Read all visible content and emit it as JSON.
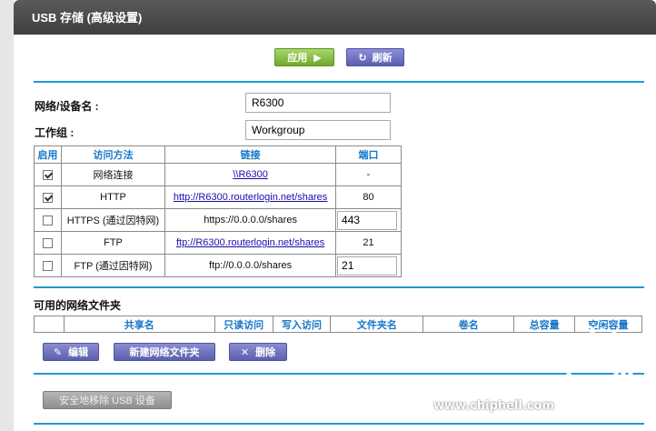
{
  "window": {
    "title": "USB 存储 (高级设置)"
  },
  "toolbar": {
    "apply_label": "应用",
    "refresh_label": "刷新"
  },
  "form": {
    "device_name_label": "网络/设备名 :",
    "device_name_value": "R6300",
    "workgroup_label": "工作组 :",
    "workgroup_value": "Workgroup"
  },
  "access_table": {
    "headers": [
      "启用",
      "访问方法",
      "链接",
      "端口"
    ],
    "rows": [
      {
        "enabled": true,
        "method": "网络连接",
        "link": "\\\\R6300",
        "link_is_url": true,
        "port": "-",
        "port_editable": false
      },
      {
        "enabled": true,
        "method": "HTTP",
        "link": "http://R6300.routerlogin.net/shares",
        "link_is_url": true,
        "port": "80",
        "port_editable": false
      },
      {
        "enabled": false,
        "method": "HTTPS (通过因特网)",
        "link": "https://0.0.0.0/shares",
        "link_is_url": false,
        "port": "443",
        "port_editable": true
      },
      {
        "enabled": false,
        "method": "FTP",
        "link": "ftp://R6300.routerlogin.net/shares",
        "link_is_url": true,
        "port": "21",
        "port_editable": false
      },
      {
        "enabled": false,
        "method": "FTP (通过因特网)",
        "link": "ftp://0.0.0.0/shares",
        "link_is_url": false,
        "port": "21",
        "port_editable": true
      }
    ]
  },
  "folders": {
    "section_title": "可用的网络文件夹",
    "headers": [
      "",
      "共享名",
      "只读访问",
      "写入访问",
      "文件夹名",
      "卷名",
      "总容量",
      "空闲容量"
    ],
    "edit_label": "编辑",
    "new_label": "新建网络文件夹",
    "delete_label": "删除"
  },
  "safe_remove_label": "安全地移除 USB 设备",
  "watermark": {
    "url": "www.chiphell.com",
    "logo_text": "chip hell"
  },
  "colors": {
    "accent": "#1e9ad6",
    "header_text": "#1677c8",
    "apply_green": "#6ea92c",
    "purple": "#5b5eb0"
  }
}
